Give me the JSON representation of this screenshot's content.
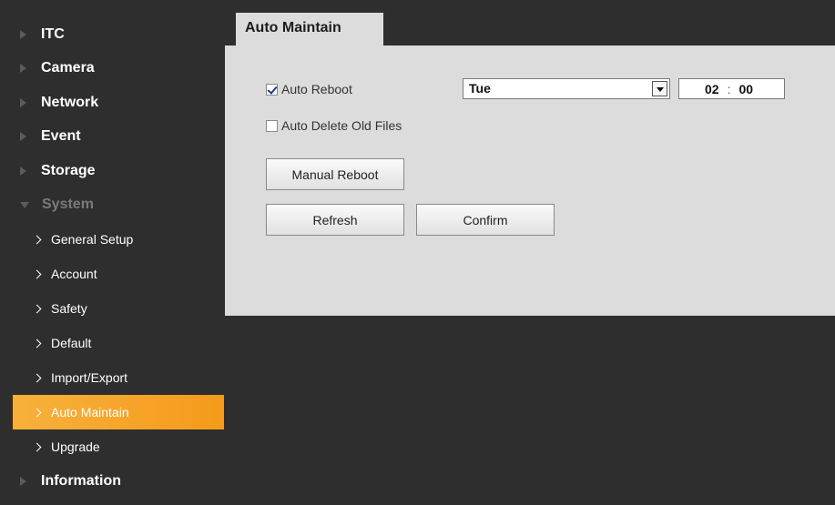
{
  "sidebar": {
    "sections_top": [
      "ITC",
      "Camera",
      "Network",
      "Event",
      "Storage"
    ],
    "system": {
      "label": "System",
      "items": [
        "General Setup",
        "Account",
        "Safety",
        "Default",
        "Import/Export",
        "Auto Maintain",
        "Upgrade"
      ]
    },
    "information": "Information"
  },
  "main": {
    "tab_label": "Auto Maintain",
    "auto_reboot": {
      "label": "Auto Reboot",
      "checked": true,
      "day": "Tue",
      "hour": "02",
      "minute": "00",
      "separator": ":"
    },
    "auto_delete": {
      "label": "Auto Delete Old Files",
      "checked": false
    },
    "buttons": {
      "manual_reboot": "Manual Reboot",
      "refresh": "Refresh",
      "confirm": "Confirm"
    }
  }
}
